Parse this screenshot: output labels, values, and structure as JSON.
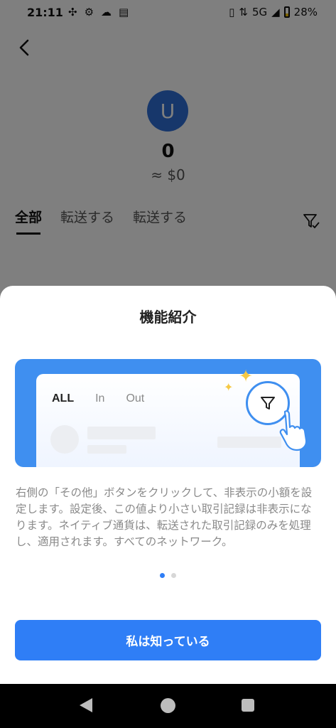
{
  "status_bar": {
    "time": "21:11",
    "network": "5G",
    "battery": "28%"
  },
  "account": {
    "avatar_letter": "U",
    "balance": "0",
    "balance_usd": "≈ $0"
  },
  "tabs": [
    {
      "label": "全部",
      "active": true
    },
    {
      "label": "転送する",
      "active": false
    },
    {
      "label": "転送する",
      "active": false
    }
  ],
  "sheet": {
    "title": "機能紹介",
    "illustration": {
      "tabs": [
        "ALL",
        "In",
        "Out"
      ]
    },
    "description": "右側の「その他」ボタンをクリックして、非表示の小額を設定します。設定後、この値より小さい取引記録は非表示になります。ネイティブ通貨は、転送された取引記録のみを処理し、適用されます。すべてのネットワーク。",
    "pagination": {
      "current": 1,
      "total": 2
    },
    "confirm_button": "私は知っている"
  },
  "colors": {
    "accent": "#2f7ef6",
    "avatar": "#2f6fd6",
    "illustration_bg": "#3f8ff0",
    "sparkle": "#f6c945"
  }
}
